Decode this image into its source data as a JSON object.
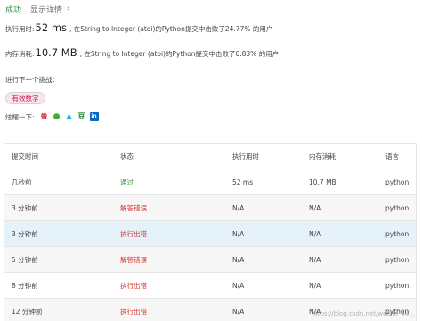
{
  "header": {
    "status": "成功",
    "details_link": "显示详情",
    "details_chevron": "›"
  },
  "runtime": {
    "label": "执行用时:",
    "value": "52 ms",
    "description": ", 在String to Integer (atoi)的Python提交中击败了24.77% 的用户"
  },
  "memory": {
    "label": "内存消耗:",
    "value": "10.7 MB",
    "description": ", 在String to Integer (atoi)的Python提交中击败了0.83% 的用户"
  },
  "next_challenge": {
    "label": "进行下一个挑战：",
    "tag": "有效数字"
  },
  "share": {
    "label": "炫耀一下:",
    "icons": [
      {
        "name": "weibo-icon",
        "glyph": "微"
      },
      {
        "name": "wechat-icon",
        "glyph": "●"
      },
      {
        "name": "qq-icon",
        "glyph": "▲"
      },
      {
        "name": "douban-icon",
        "glyph": "豆"
      },
      {
        "name": "linkedin-icon",
        "glyph": "in"
      }
    ]
  },
  "table": {
    "headers": [
      "提交时间",
      "状态",
      "执行用时",
      "内存消耗",
      "语言"
    ],
    "rows": [
      {
        "time": "几秒前",
        "status": "通过",
        "runtime": "52 ms",
        "memory": "10.7 MB",
        "language": "python",
        "status_kind": "ok"
      },
      {
        "time": "3 分钟前",
        "status": "解答错误",
        "runtime": "N/A",
        "memory": "N/A",
        "language": "python",
        "status_kind": "err"
      },
      {
        "time": "3 分钟前",
        "status": "执行出错",
        "runtime": "N/A",
        "memory": "N/A",
        "language": "python",
        "status_kind": "err"
      },
      {
        "time": "5 分钟前",
        "status": "解答错误",
        "runtime": "N/A",
        "memory": "N/A",
        "language": "python",
        "status_kind": "err"
      },
      {
        "time": "8 分钟前",
        "status": "执行出错",
        "runtime": "N/A",
        "memory": "N/A",
        "language": "python",
        "status_kind": "err"
      },
      {
        "time": "12 分钟前",
        "status": "执行出错",
        "runtime": "N/A",
        "memory": "N/A",
        "language": "python",
        "status_kind": "err"
      }
    ]
  },
  "watermark": "https://blog.csdn.net/weixin_44..."
}
